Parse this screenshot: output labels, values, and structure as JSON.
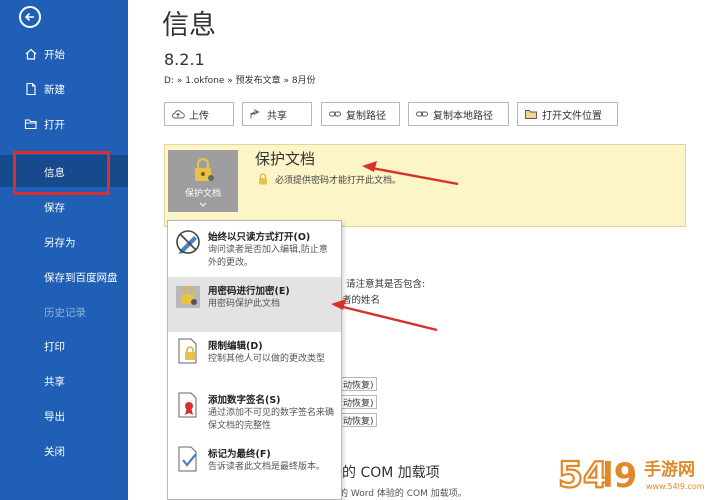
{
  "sidebar": {
    "items": [
      {
        "label": "开始"
      },
      {
        "label": "新建"
      },
      {
        "label": "打开"
      },
      {
        "label": "信息"
      },
      {
        "label": "保存"
      },
      {
        "label": "另存为"
      },
      {
        "label": "保存到百度网盘"
      },
      {
        "label": "历史记录"
      },
      {
        "label": "打印"
      },
      {
        "label": "共享"
      },
      {
        "label": "导出"
      },
      {
        "label": "关闭"
      }
    ]
  },
  "main": {
    "title": "信息",
    "doc_name": "8.2.1",
    "doc_path": "D: » 1.okfone » 预发布文章 » 8月份",
    "toolbar": [
      {
        "label": "上传"
      },
      {
        "label": "共享"
      },
      {
        "label": "复制路径"
      },
      {
        "label": "复制本地路径"
      },
      {
        "label": "打开文件位置"
      }
    ],
    "protect": {
      "button_label": "保护文档",
      "title": "保护文档",
      "desc": "必须提供密码才能打开此文档。"
    },
    "background": {
      "inspect_text": "请注意其是否包含:",
      "author_text": "者的姓名",
      "restore_buttons": [
        "动恢复)",
        "动恢复)",
        "动恢复)"
      ],
      "com_title": "禁用的 COM 加载项",
      "com_desc": "响你的 Word 体验的 COM 加载项。"
    }
  },
  "dropdown": {
    "items": [
      {
        "title": "始终以只读方式打开(O)",
        "desc": "询问读者是否加入编辑,防止意外的更改。"
      },
      {
        "title": "用密码进行加密(E)",
        "desc": "用密码保护此文档"
      },
      {
        "title": "限制编辑(D)",
        "desc": "控制其他人可以做的更改类型"
      },
      {
        "title": "添加数字签名(S)",
        "desc": "通过添加不可见的数字签名来确保文档的完整性"
      },
      {
        "title": "标记为最终(F)",
        "desc": "告诉读者此文档是最终版本。"
      }
    ]
  },
  "watermark": {
    "text": "54l9手游网",
    "sub": "www.54l9.com"
  },
  "colors": {
    "sidebar": "#1f5fb5",
    "sidebar_selected": "#174a8d",
    "annotation_red": "#d9302c",
    "protect_panel": "#fbf5c7"
  }
}
